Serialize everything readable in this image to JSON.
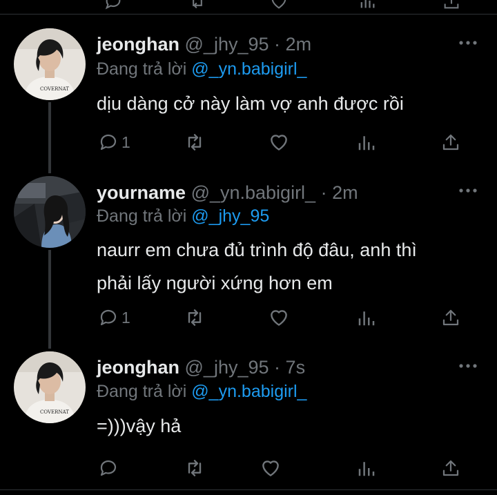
{
  "tweets": [
    {
      "name": "jeonghan",
      "handle": "@_jhy_95",
      "separator": "·",
      "time": "2m",
      "replying_prefix": "Đang trả lời",
      "replying_to": "@_yn.babigirl_",
      "text_lines": [
        "dịu dàng cở này làm vợ anh được rồi"
      ],
      "reply_count": "1",
      "avatar_icon": "person-photo-covernat"
    },
    {
      "name": "yourname",
      "handle": "@_yn.babigirl_",
      "separator": "·",
      "time": "2m",
      "replying_prefix": "Đang trả lời",
      "replying_to": "@_jhy_95",
      "text_lines": [
        "naurr em chưa đủ trình độ đâu, anh thì",
        "phải lấy người xứng hơn em"
      ],
      "reply_count": "1",
      "avatar_icon": "person-photo-car"
    },
    {
      "name": "jeonghan",
      "handle": "@_jhy_95",
      "separator": "·",
      "time": "7s",
      "replying_prefix": "Đang trả lời",
      "replying_to": "@_yn.babigirl_",
      "text_lines": [
        "=)))vậy hả"
      ],
      "reply_count": "",
      "avatar_icon": "person-photo-covernat"
    }
  ],
  "avatar_shirt_text": "COVERNAT",
  "colors": {
    "background": "#000000",
    "primary_text": "#e7e9ea",
    "secondary_text": "#71767b",
    "link": "#1d9bf0",
    "thread_line": "#333639"
  }
}
